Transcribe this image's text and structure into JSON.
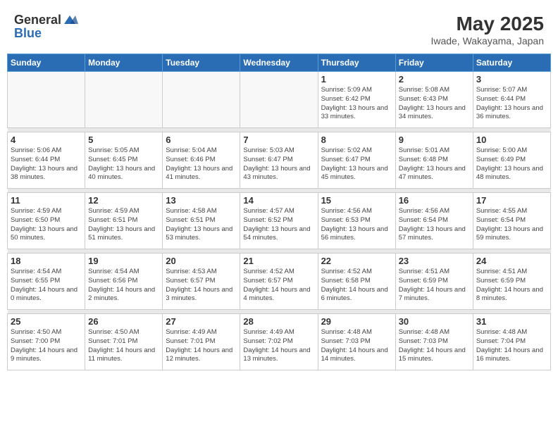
{
  "logo": {
    "text1": "General",
    "text2": "Blue"
  },
  "header": {
    "month_year": "May 2025",
    "location": "Iwade, Wakayama, Japan"
  },
  "days_of_week": [
    "Sunday",
    "Monday",
    "Tuesday",
    "Wednesday",
    "Thursday",
    "Friday",
    "Saturday"
  ],
  "weeks": [
    {
      "days": [
        {
          "num": "",
          "empty": true
        },
        {
          "num": "",
          "empty": true
        },
        {
          "num": "",
          "empty": true
        },
        {
          "num": "",
          "empty": true
        },
        {
          "num": "1",
          "sunrise": "5:09 AM",
          "sunset": "6:42 PM",
          "daylight": "13 hours and 33 minutes."
        },
        {
          "num": "2",
          "sunrise": "5:08 AM",
          "sunset": "6:43 PM",
          "daylight": "13 hours and 34 minutes."
        },
        {
          "num": "3",
          "sunrise": "5:07 AM",
          "sunset": "6:44 PM",
          "daylight": "13 hours and 36 minutes."
        }
      ]
    },
    {
      "days": [
        {
          "num": "4",
          "sunrise": "5:06 AM",
          "sunset": "6:44 PM",
          "daylight": "13 hours and 38 minutes."
        },
        {
          "num": "5",
          "sunrise": "5:05 AM",
          "sunset": "6:45 PM",
          "daylight": "13 hours and 40 minutes."
        },
        {
          "num": "6",
          "sunrise": "5:04 AM",
          "sunset": "6:46 PM",
          "daylight": "13 hours and 41 minutes."
        },
        {
          "num": "7",
          "sunrise": "5:03 AM",
          "sunset": "6:47 PM",
          "daylight": "13 hours and 43 minutes."
        },
        {
          "num": "8",
          "sunrise": "5:02 AM",
          "sunset": "6:47 PM",
          "daylight": "13 hours and 45 minutes."
        },
        {
          "num": "9",
          "sunrise": "5:01 AM",
          "sunset": "6:48 PM",
          "daylight": "13 hours and 47 minutes."
        },
        {
          "num": "10",
          "sunrise": "5:00 AM",
          "sunset": "6:49 PM",
          "daylight": "13 hours and 48 minutes."
        }
      ]
    },
    {
      "days": [
        {
          "num": "11",
          "sunrise": "4:59 AM",
          "sunset": "6:50 PM",
          "daylight": "13 hours and 50 minutes."
        },
        {
          "num": "12",
          "sunrise": "4:59 AM",
          "sunset": "6:51 PM",
          "daylight": "13 hours and 51 minutes."
        },
        {
          "num": "13",
          "sunrise": "4:58 AM",
          "sunset": "6:51 PM",
          "daylight": "13 hours and 53 minutes."
        },
        {
          "num": "14",
          "sunrise": "4:57 AM",
          "sunset": "6:52 PM",
          "daylight": "13 hours and 54 minutes."
        },
        {
          "num": "15",
          "sunrise": "4:56 AM",
          "sunset": "6:53 PM",
          "daylight": "13 hours and 56 minutes."
        },
        {
          "num": "16",
          "sunrise": "4:56 AM",
          "sunset": "6:54 PM",
          "daylight": "13 hours and 57 minutes."
        },
        {
          "num": "17",
          "sunrise": "4:55 AM",
          "sunset": "6:54 PM",
          "daylight": "13 hours and 59 minutes."
        }
      ]
    },
    {
      "days": [
        {
          "num": "18",
          "sunrise": "4:54 AM",
          "sunset": "6:55 PM",
          "daylight": "14 hours and 0 minutes."
        },
        {
          "num": "19",
          "sunrise": "4:54 AM",
          "sunset": "6:56 PM",
          "daylight": "14 hours and 2 minutes."
        },
        {
          "num": "20",
          "sunrise": "4:53 AM",
          "sunset": "6:57 PM",
          "daylight": "14 hours and 3 minutes."
        },
        {
          "num": "21",
          "sunrise": "4:52 AM",
          "sunset": "6:57 PM",
          "daylight": "14 hours and 4 minutes."
        },
        {
          "num": "22",
          "sunrise": "4:52 AM",
          "sunset": "6:58 PM",
          "daylight": "14 hours and 6 minutes."
        },
        {
          "num": "23",
          "sunrise": "4:51 AM",
          "sunset": "6:59 PM",
          "daylight": "14 hours and 7 minutes."
        },
        {
          "num": "24",
          "sunrise": "4:51 AM",
          "sunset": "6:59 PM",
          "daylight": "14 hours and 8 minutes."
        }
      ]
    },
    {
      "days": [
        {
          "num": "25",
          "sunrise": "4:50 AM",
          "sunset": "7:00 PM",
          "daylight": "14 hours and 9 minutes."
        },
        {
          "num": "26",
          "sunrise": "4:50 AM",
          "sunset": "7:01 PM",
          "daylight": "14 hours and 11 minutes."
        },
        {
          "num": "27",
          "sunrise": "4:49 AM",
          "sunset": "7:01 PM",
          "daylight": "14 hours and 12 minutes."
        },
        {
          "num": "28",
          "sunrise": "4:49 AM",
          "sunset": "7:02 PM",
          "daylight": "14 hours and 13 minutes."
        },
        {
          "num": "29",
          "sunrise": "4:48 AM",
          "sunset": "7:03 PM",
          "daylight": "14 hours and 14 minutes."
        },
        {
          "num": "30",
          "sunrise": "4:48 AM",
          "sunset": "7:03 PM",
          "daylight": "14 hours and 15 minutes."
        },
        {
          "num": "31",
          "sunrise": "4:48 AM",
          "sunset": "7:04 PM",
          "daylight": "14 hours and 16 minutes."
        }
      ]
    }
  ]
}
